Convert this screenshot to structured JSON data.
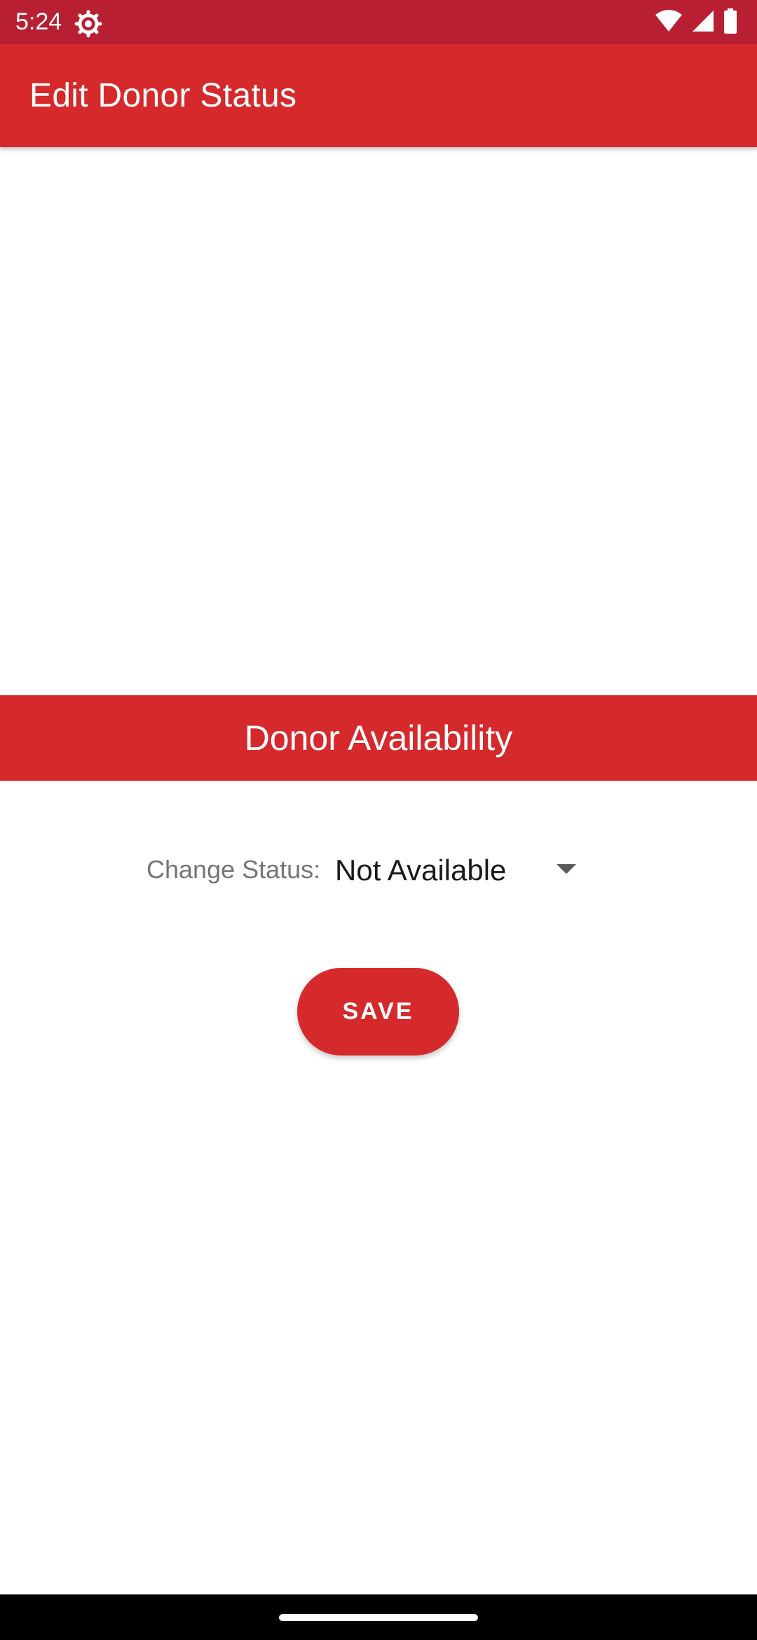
{
  "status_bar": {
    "time": "5:24",
    "left_icons": [
      "gear-icon"
    ],
    "right_icons": [
      "wifi-icon",
      "signal-icon",
      "battery-icon"
    ]
  },
  "app_bar": {
    "title": "Edit Donor Status"
  },
  "section": {
    "title": "Donor Availability"
  },
  "status_form": {
    "label": "Change Status:",
    "selected_value": "Not Available"
  },
  "actions": {
    "save_label": "SAVE"
  },
  "colors": {
    "status_bar": "#B91F32",
    "primary": "#D6292C",
    "label_text": "#757575",
    "value_text": "#1A1A1A"
  }
}
